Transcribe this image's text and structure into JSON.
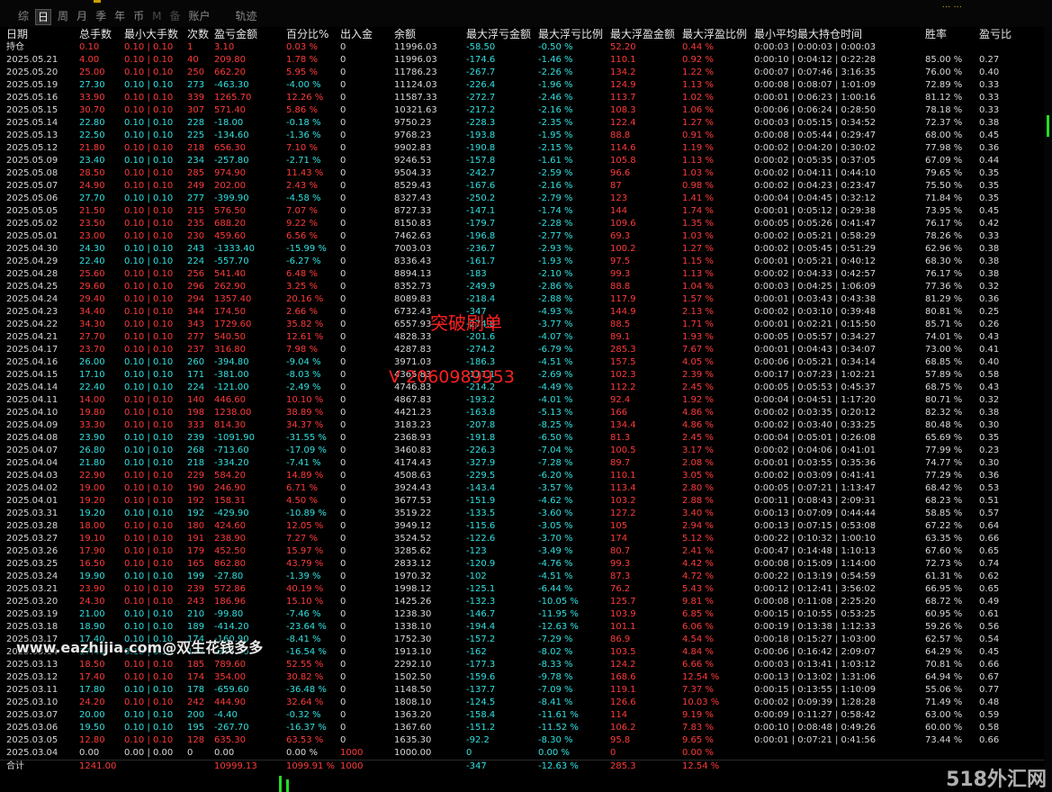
{
  "tabs": [
    "综",
    "日",
    "周",
    "月",
    "季",
    "年",
    "币",
    "M",
    "备",
    "账户",
    "轨迹"
  ],
  "active_tab": "日",
  "top_right_text": "... ...",
  "headers": [
    "日期",
    "总手数",
    "最小大手数",
    "次数",
    "盈亏金额",
    "百分比%",
    "出入金",
    "余额",
    "最大浮亏金额",
    "最大浮亏比例",
    "最大浮盈金额",
    "最大浮盈比例",
    "最小平均最大持仓时间",
    "胜率",
    "盈亏比"
  ],
  "rows": [
    [
      "持仓",
      "0.10",
      "0.10 | 0.10",
      "1",
      "3.10",
      "0.03 %",
      "0",
      "11996.03",
      "-58.50",
      "-0.50 %",
      "52.20",
      "0.44 %",
      "0:00:03 | 0:00:03 | 0:00:03",
      "",
      ""
    ],
    [
      "2025.05.21",
      "4.00",
      "0.10 | 0.10",
      "40",
      "209.80",
      "1.78 %",
      "0",
      "11996.03",
      "-174.6",
      "-1.46 %",
      "110.1",
      "0.92 %",
      "0:00:10 | 0:04:12 | 0:22:28",
      "85.00 %",
      "0.27"
    ],
    [
      "2025.05.20",
      "25.00",
      "0.10 | 0.10",
      "250",
      "662.20",
      "5.95 %",
      "0",
      "11786.23",
      "-267.7",
      "-2.26 %",
      "134.2",
      "1.22 %",
      "0:00:07 | 0:07:46 | 3:16:35",
      "76.00 %",
      "0.40"
    ],
    [
      "2025.05.19",
      "27.30",
      "0.10 | 0.10",
      "273",
      "-463.30",
      "-4.00 %",
      "0",
      "11124.03",
      "-226.4",
      "-1.96 %",
      "124.9",
      "1.13 %",
      "0:00:08 | 0:08:07 | 1:01:09",
      "72.89 %",
      "0.33"
    ],
    [
      "2025.05.16",
      "33.90",
      "0.10 | 0.10",
      "339",
      "1265.70",
      "12.26 %",
      "0",
      "11587.33",
      "-272.7",
      "-2.46 %",
      "113.7",
      "1.02 %",
      "0:00:01 | 0:06:23 | 1:00:16",
      "81.12 %",
      "0.33"
    ],
    [
      "2025.05.15",
      "30.70",
      "0.10 | 0.10",
      "307",
      "571.40",
      "5.86 %",
      "0",
      "10321.63",
      "-217.2",
      "-2.16 %",
      "108.3",
      "1.06 %",
      "0:00:06 | 0:06:24 | 0:28:50",
      "78.18 %",
      "0.33"
    ],
    [
      "2025.05.14",
      "22.80",
      "0.10 | 0.10",
      "228",
      "-18.00",
      "-0.18 %",
      "0",
      "9750.23",
      "-228.3",
      "-2.35 %",
      "122.4",
      "1.27 %",
      "0:00:03 | 0:05:15 | 0:34:52",
      "72.37 %",
      "0.38"
    ],
    [
      "2025.05.13",
      "22.50",
      "0.10 | 0.10",
      "225",
      "-134.60",
      "-1.36 %",
      "0",
      "9768.23",
      "-193.8",
      "-1.95 %",
      "88.8",
      "0.91 %",
      "0:00:08 | 0:05:44 | 0:29:47",
      "68.00 %",
      "0.45"
    ],
    [
      "2025.05.12",
      "21.80",
      "0.10 | 0.10",
      "218",
      "656.30",
      "7.10 %",
      "0",
      "9902.83",
      "-190.8",
      "-2.15 %",
      "114.6",
      "1.19 %",
      "0:00:02 | 0:04:20 | 0:30:02",
      "77.98 %",
      "0.36"
    ],
    [
      "2025.05.09",
      "23.40",
      "0.10 | 0.10",
      "234",
      "-257.80",
      "-2.71 %",
      "0",
      "9246.53",
      "-157.8",
      "-1.61 %",
      "105.8",
      "1.13 %",
      "0:00:02 | 0:05:35 | 0:37:05",
      "67.09 %",
      "0.44"
    ],
    [
      "2025.05.08",
      "28.50",
      "0.10 | 0.10",
      "285",
      "974.90",
      "11.43 %",
      "0",
      "9504.33",
      "-242.7",
      "-2.59 %",
      "96.6",
      "1.03 %",
      "0:00:02 | 0:04:11 | 0:44:10",
      "79.65 %",
      "0.35"
    ],
    [
      "2025.05.07",
      "24.90",
      "0.10 | 0.10",
      "249",
      "202.00",
      "2.43 %",
      "0",
      "8529.43",
      "-167.6",
      "-2.16 %",
      "87",
      "0.98 %",
      "0:00:02 | 0:04:23 | 0:23:47",
      "75.50 %",
      "0.35"
    ],
    [
      "2025.05.06",
      "27.70",
      "0.10 | 0.10",
      "277",
      "-399.90",
      "-4.58 %",
      "0",
      "8327.43",
      "-250.2",
      "-2.79 %",
      "123",
      "1.41 %",
      "0:00:04 | 0:04:45 | 0:32:12",
      "71.84 %",
      "0.35"
    ],
    [
      "2025.05.05",
      "21.50",
      "0.10 | 0.10",
      "215",
      "576.50",
      "7.07 %",
      "0",
      "8727.33",
      "-147.1",
      "-1.74 %",
      "144",
      "1.74 %",
      "0:00:01 | 0:05:12 | 0:29:38",
      "73.95 %",
      "0.45"
    ],
    [
      "2025.05.02",
      "23.50",
      "0.10 | 0.10",
      "235",
      "688.20",
      "9.22 %",
      "0",
      "8150.83",
      "-179.7",
      "-2.28 %",
      "109.6",
      "1.35 %",
      "0:00:05 | 0:05:26 | 0:41:47",
      "76.17 %",
      "0.42"
    ],
    [
      "2025.05.01",
      "23.00",
      "0.10 | 0.10",
      "230",
      "459.60",
      "6.56 %",
      "0",
      "7462.63",
      "-196.8",
      "-2.77 %",
      "69.3",
      "1.03 %",
      "0:00:02 | 0:05:21 | 0:58:29",
      "78.26 %",
      "0.33"
    ],
    [
      "2025.04.30",
      "24.30",
      "0.10 | 0.10",
      "243",
      "-1333.40",
      "-15.99 %",
      "0",
      "7003.03",
      "-236.7",
      "-2.93 %",
      "100.2",
      "1.27 %",
      "0:00:02 | 0:05:45 | 0:51:29",
      "62.96 %",
      "0.38"
    ],
    [
      "2025.04.29",
      "22.40",
      "0.10 | 0.10",
      "224",
      "-557.70",
      "-6.27 %",
      "0",
      "8336.43",
      "-161.7",
      "-1.93 %",
      "97.5",
      "1.15 %",
      "0:00:01 | 0:05:21 | 0:40:12",
      "68.30 %",
      "0.38"
    ],
    [
      "2025.04.28",
      "25.60",
      "0.10 | 0.10",
      "256",
      "541.40",
      "6.48 %",
      "0",
      "8894.13",
      "-183",
      "-2.10 %",
      "99.3",
      "1.13 %",
      "0:00:02 | 0:04:33 | 0:42:57",
      "76.17 %",
      "0.38"
    ],
    [
      "2025.04.25",
      "29.60",
      "0.10 | 0.10",
      "296",
      "262.90",
      "3.25 %",
      "0",
      "8352.73",
      "-249.9",
      "-2.86 %",
      "88.8",
      "1.04 %",
      "0:00:03 | 0:04:25 | 1:06:09",
      "77.36 %",
      "0.32"
    ],
    [
      "2025.04.24",
      "29.40",
      "0.10 | 0.10",
      "294",
      "1357.40",
      "20.16 %",
      "0",
      "8089.83",
      "-218.4",
      "-2.88 %",
      "117.9",
      "1.57 %",
      "0:00:01 | 0:03:43 | 0:43:38",
      "81.29 %",
      "0.36"
    ],
    [
      "2025.04.23",
      "34.40",
      "0.10 | 0.10",
      "344",
      "174.50",
      "2.66 %",
      "0",
      "6732.43",
      "-347",
      "-4.93 %",
      "144.9",
      "2.13 %",
      "0:00:02 | 0:03:10 | 0:39:48",
      "80.81 %",
      "0.25"
    ],
    [
      "2025.04.22",
      "34.30",
      "0.10 | 0.10",
      "343",
      "1729.60",
      "35.82 %",
      "0",
      "6557.93",
      "-274.8",
      "-3.77 %",
      "88.5",
      "1.71 %",
      "0:00:01 | 0:02:21 | 0:15:50",
      "85.71 %",
      "0.26"
    ],
    [
      "2025.04.21",
      "27.70",
      "0.10 | 0.10",
      "277",
      "540.50",
      "12.61 %",
      "0",
      "4828.33",
      "-201.6",
      "-4.07 %",
      "89.1",
      "1.93 %",
      "0:00:05 | 0:05:57 | 0:34:27",
      "74.01 %",
      "0.43"
    ],
    [
      "2025.04.17",
      "23.70",
      "0.10 | 0.10",
      "237",
      "316.80",
      "7.98 %",
      "0",
      "4287.83",
      "-274.2",
      "-6.79 %",
      "285.3",
      "7.67 %",
      "0:00:01 | 0:04:43 | 0:34:07",
      "73.00 %",
      "0.41"
    ],
    [
      "2025.04.16",
      "26.00",
      "0.10 | 0.10",
      "260",
      "-394.80",
      "-9.04 %",
      "0",
      "3971.03",
      "-186.3",
      "-4.51 %",
      "157.5",
      "4.05 %",
      "0:00:06 | 0:05:21 | 0:34:14",
      "68.85 %",
      "0.40"
    ],
    [
      "2025.04.15",
      "17.10",
      "0.10 | 0.10",
      "171",
      "-381.00",
      "-8.03 %",
      "0",
      "4365.83",
      "-117.1",
      "-2.69 %",
      "102.3",
      "2.39 %",
      "0:00:17 | 0:07:23 | 1:02:21",
      "57.89 %",
      "0.58"
    ],
    [
      "2025.04.14",
      "22.40",
      "0.10 | 0.10",
      "224",
      "-121.00",
      "-2.49 %",
      "0",
      "4746.83",
      "-214.2",
      "-4.49 %",
      "112.2",
      "2.45 %",
      "0:00:05 | 0:05:53 | 0:45:37",
      "68.75 %",
      "0.43"
    ],
    [
      "2025.04.11",
      "14.00",
      "0.10 | 0.10",
      "140",
      "446.60",
      "10.10 %",
      "0",
      "4867.83",
      "-193.2",
      "-4.01 %",
      "92.4",
      "1.92 %",
      "0:00:04 | 0:04:51 | 1:17:20",
      "80.71 %",
      "0.32"
    ],
    [
      "2025.04.10",
      "19.80",
      "0.10 | 0.10",
      "198",
      "1238.00",
      "38.89 %",
      "0",
      "4421.23",
      "-163.8",
      "-5.13 %",
      "166",
      "4.86 %",
      "0:00:02 | 0:03:35 | 0:20:12",
      "82.32 %",
      "0.38"
    ],
    [
      "2025.04.09",
      "33.30",
      "0.10 | 0.10",
      "333",
      "814.30",
      "34.37 %",
      "0",
      "3183.23",
      "-207.8",
      "-8.25 %",
      "134.4",
      "4.86 %",
      "0:00:02 | 0:03:40 | 0:33:25",
      "80.48 %",
      "0.30"
    ],
    [
      "2025.04.08",
      "23.90",
      "0.10 | 0.10",
      "239",
      "-1091.90",
      "-31.55 %",
      "0",
      "2368.93",
      "-191.8",
      "-6.50 %",
      "81.3",
      "2.45 %",
      "0:00:04 | 0:05:01 | 0:26:08",
      "65.69 %",
      "0.35"
    ],
    [
      "2025.04.07",
      "26.80",
      "0.10 | 0.10",
      "268",
      "-713.60",
      "-17.09 %",
      "0",
      "3460.83",
      "-226.3",
      "-7.04 %",
      "100.5",
      "3.17 %",
      "0:00:02 | 0:04:06 | 0:41:01",
      "77.99 %",
      "0.23"
    ],
    [
      "2025.04.04",
      "21.80",
      "0.10 | 0.10",
      "218",
      "-334.20",
      "-7.41 %",
      "0",
      "4174.43",
      "-327.9",
      "-7.28 %",
      "89.7",
      "2.08 %",
      "0:00:01 | 0:03:55 | 0:35:36",
      "74.77 %",
      "0.30"
    ],
    [
      "2025.04.03",
      "22.90",
      "0.10 | 0.10",
      "229",
      "584.20",
      "14.89 %",
      "0",
      "4508.63",
      "-229.5",
      "-6.20 %",
      "110.1",
      "3.05 %",
      "0:00:02 | 0:03:09 | 0:41:41",
      "77.29 %",
      "0.36"
    ],
    [
      "2025.04.02",
      "19.00",
      "0.10 | 0.10",
      "190",
      "246.90",
      "6.71 %",
      "0",
      "3924.43",
      "-143.4",
      "-3.57 %",
      "113.4",
      "2.80 %",
      "0:00:05 | 0:07:21 | 1:13:47",
      "68.42 %",
      "0.53"
    ],
    [
      "2025.04.01",
      "19.20",
      "0.10 | 0.10",
      "192",
      "158.31",
      "4.50 %",
      "0",
      "3677.53",
      "-151.9",
      "-4.62 %",
      "103.2",
      "2.88 %",
      "0:00:11 | 0:08:43 | 2:09:31",
      "68.23 %",
      "0.51"
    ],
    [
      "2025.03.31",
      "19.20",
      "0.10 | 0.10",
      "192",
      "-429.90",
      "-10.89 %",
      "0",
      "3519.22",
      "-133.5",
      "-3.60 %",
      "127.2",
      "3.40 %",
      "0:00:13 | 0:07:09 | 0:44:44",
      "58.85 %",
      "0.57"
    ],
    [
      "2025.03.28",
      "18.00",
      "0.10 | 0.10",
      "180",
      "424.60",
      "12.05 %",
      "0",
      "3949.12",
      "-115.6",
      "-3.05 %",
      "105",
      "2.94 %",
      "0:00:13 | 0:07:15 | 0:53:08",
      "67.22 %",
      "0.64"
    ],
    [
      "2025.03.27",
      "19.10",
      "0.10 | 0.10",
      "191",
      "238.90",
      "7.27 %",
      "0",
      "3524.52",
      "-122.6",
      "-3.70 %",
      "174",
      "5.12 %",
      "0:00:22 | 0:10:32 | 1:00:10",
      "63.35 %",
      "0.66"
    ],
    [
      "2025.03.26",
      "17.90",
      "0.10 | 0.10",
      "179",
      "452.50",
      "15.97 %",
      "0",
      "3285.62",
      "-123",
      "-3.49 %",
      "80.7",
      "2.41 %",
      "0:00:47 | 0:14:48 | 1:10:13",
      "67.60 %",
      "0.65"
    ],
    [
      "2025.03.25",
      "16.50",
      "0.10 | 0.10",
      "165",
      "862.80",
      "43.79 %",
      "0",
      "2833.12",
      "-120.9",
      "-4.76 %",
      "99.3",
      "4.42 %",
      "0:00:08 | 0:15:09 | 1:14:00",
      "72.73 %",
      "0.74"
    ],
    [
      "2025.03.24",
      "19.90",
      "0.10 | 0.10",
      "199",
      "-27.80",
      "-1.39 %",
      "0",
      "1970.32",
      "-102",
      "-4.51 %",
      "87.3",
      "4.72 %",
      "0:00:22 | 0:13:19 | 0:54:59",
      "61.31 %",
      "0.62"
    ],
    [
      "2025.03.21",
      "23.90",
      "0.10 | 0.10",
      "239",
      "572.86",
      "40.19 %",
      "0",
      "1998.12",
      "-125.1",
      "-6.44 %",
      "76.2",
      "5.43 %",
      "0:00:12 | 0:12:41 | 3:56:02",
      "66.95 %",
      "0.65"
    ],
    [
      "2025.03.20",
      "24.30",
      "0.10 | 0.10",
      "243",
      "186.96",
      "15.10 %",
      "0",
      "1425.26",
      "-132.3",
      "-10.05 %",
      "125.7",
      "9.81 %",
      "0:00:08 | 0:11:08 | 2:25:20",
      "68.72 %",
      "0.49"
    ],
    [
      "2025.03.19",
      "21.00",
      "0.10 | 0.10",
      "210",
      "-99.80",
      "-7.46 %",
      "0",
      "1238.30",
      "-146.7",
      "-11.95 %",
      "103.9",
      "6.85 %",
      "0:00:15 | 0:10:55 | 0:53:25",
      "60.95 %",
      "0.61"
    ],
    [
      "2025.03.18",
      "18.90",
      "0.10 | 0.10",
      "189",
      "-414.20",
      "-23.64 %",
      "0",
      "1338.10",
      "-194.4",
      "-12.63 %",
      "101.1",
      "6.06 %",
      "0:00:19 | 0:13:38 | 1:12:33",
      "59.26 %",
      "0.56"
    ],
    [
      "2025.03.17",
      "17.40",
      "0.10 | 0.10",
      "174",
      "-160.90",
      "-8.41 %",
      "0",
      "1752.30",
      "-157.2",
      "-7.29 %",
      "86.9",
      "4.54 %",
      "0:00:18 | 0:15:27 | 1:03:00",
      "62.57 %",
      "0.54"
    ],
    [
      "2025.03.14",
      "17.40",
      "0.10 | 0.10",
      "174",
      "-379.20",
      "-16.54 %",
      "0",
      "1913.10",
      "-162",
      "-8.02 %",
      "103.5",
      "4.84 %",
      "0:00:06 | 0:16:42 | 2:09:07",
      "64.29 %",
      "0.45"
    ],
    [
      "2025.03.13",
      "18.50",
      "0.10 | 0.10",
      "185",
      "789.60",
      "52.55 %",
      "0",
      "2292.10",
      "-177.3",
      "-8.33 %",
      "124.2",
      "6.66 %",
      "0:00:03 | 0:13:41 | 1:03:12",
      "70.81 %",
      "0.66"
    ],
    [
      "2025.03.12",
      "17.40",
      "0.10 | 0.10",
      "174",
      "354.00",
      "30.82 %",
      "0",
      "1502.50",
      "-159.6",
      "-9.78 %",
      "168.6",
      "12.54 %",
      "0:00:13 | 0:13:02 | 1:31:06",
      "64.94 %",
      "0.67"
    ],
    [
      "2025.03.11",
      "17.80",
      "0.10 | 0.10",
      "178",
      "-659.60",
      "-36.48 %",
      "0",
      "1148.50",
      "-137.7",
      "-7.09 %",
      "119.1",
      "7.37 %",
      "0:00:15 | 0:13:55 | 1:10:09",
      "55.06 %",
      "0.77"
    ],
    [
      "2025.03.10",
      "24.20",
      "0.10 | 0.10",
      "242",
      "444.90",
      "32.64 %",
      "0",
      "1808.10",
      "-124.5",
      "-8.41 %",
      "126.6",
      "10.03 %",
      "0:00:02 | 0:09:39 | 1:28:28",
      "71.49 %",
      "0.48"
    ],
    [
      "2025.03.07",
      "20.00",
      "0.10 | 0.10",
      "200",
      "-4.40",
      "-0.32 %",
      "0",
      "1363.20",
      "-158.4",
      "-11.61 %",
      "114",
      "9.19 %",
      "0:00:09 | 0:11:27 | 0:58:42",
      "63.00 %",
      "0.59"
    ],
    [
      "2025.03.06",
      "19.50",
      "0.10 | 0.10",
      "195",
      "-267.70",
      "-16.37 %",
      "0",
      "1367.60",
      "-151.2",
      "-11.52 %",
      "106.2",
      "7.83 %",
      "0:00:10 | 0:08:48 | 0:49:26",
      "60.00 %",
      "0.58"
    ],
    [
      "2025.03.05",
      "12.80",
      "0.10 | 0.10",
      "128",
      "635.30",
      "63.53 %",
      "0",
      "1635.30",
      "-92.2",
      "-8.30 %",
      "95.8",
      "9.65 %",
      "0:00:01 | 0:07:21 | 0:41:56",
      "73.44 %",
      "0.66"
    ],
    [
      "2025.03.04",
      "0.00",
      "0.00 | 0.00",
      "0",
      "0.00",
      "0.00 %",
      "1000",
      "1000.00",
      "0",
      "0.00 %",
      "0",
      "0.00 %",
      "",
      "",
      ""
    ]
  ],
  "totals": [
    "合计",
    "1241.00",
    "",
    "",
    "10999.13",
    "1099.91 %",
    "1000",
    "",
    "-347",
    "-12.63 %",
    "285.3",
    "12.54 %",
    "",
    "",
    ""
  ],
  "overlay_text_1": "突破刷单",
  "overlay_text_2": "V  2060989953",
  "watermark_url": "www.eazhijia.com@双生花钱多多",
  "watermark_corner": "518外汇网",
  "colors": {
    "positive": "#ff3b3b",
    "negative": "#33e0e0",
    "neutral": "#d8d8d8",
    "background": "#000000"
  }
}
